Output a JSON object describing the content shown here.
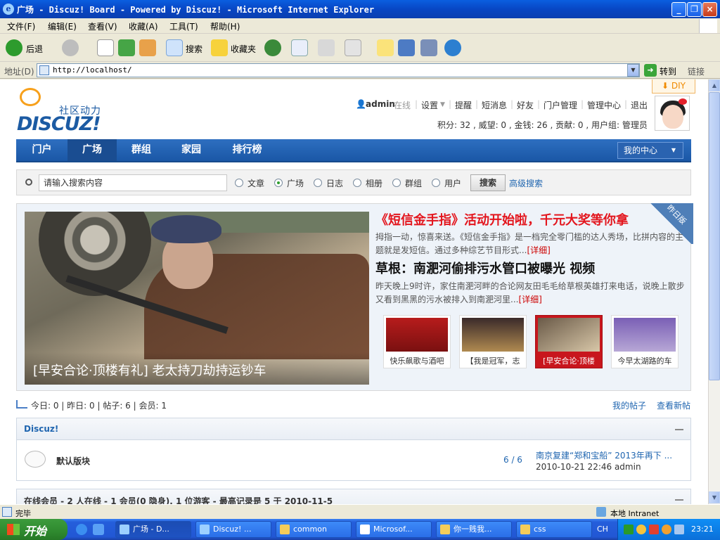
{
  "window": {
    "title": "广场 - Discuz! Board - Powered by Discuz! - Microsoft Internet Explorer"
  },
  "menu": [
    "文件(F)",
    "编辑(E)",
    "查看(V)",
    "收藏(A)",
    "工具(T)",
    "帮助(H)"
  ],
  "toolbar": {
    "back": "后退",
    "search": "搜索",
    "favorites": "收藏夹"
  },
  "address": {
    "label": "地址(D)",
    "url": "http://localhost/",
    "go": "转到",
    "links": "链接"
  },
  "header": {
    "logo_text": "DISCUZ!",
    "logo_sub": "社区动力",
    "diy": "DIY",
    "user": {
      "name": "admin",
      "status": "在线",
      "settings": "设置",
      "remind": "提醒",
      "messages": "短消息",
      "friends": "好友",
      "portal_admin": "门户管理",
      "admin_center": "管理中心",
      "logout": "退出"
    },
    "credits": "积分: 32 , 威望: 0 , 金钱: 26 , 贡献: 0 , 用户组: 管理员"
  },
  "nav": {
    "items": [
      "门户",
      "广场",
      "群组",
      "家园",
      "排行榜"
    ],
    "my_center": "我的中心"
  },
  "search": {
    "placeholder": "请输入搜索内容",
    "options": [
      "文章",
      "广场",
      "日志",
      "相册",
      "群组",
      "用户"
    ],
    "button": "搜索",
    "advanced": "高级搜索"
  },
  "feature": {
    "caption": "[早安合论·顶楼有礼] 老太持刀劫持运钞车",
    "corner": "昨日版",
    "headline1": "《短信金手指》活动开始啦，千元大奖等你拿",
    "summary1": "拇指一动，惊喜来送。《短信金手指》是一档完全零门槛的达人秀场，比拼内容的主题就是发短信。通过多种综艺节目形式...",
    "headline2": "草根：南淝河偷排污水管口被曝光 视频",
    "summary2": "昨天晚上9时许，家住南淝河畔的合论网友田毛毛给草根英雄打来电话，说晚上散步又看到黑黑的污水被排入到南淝河里...",
    "detail": "[详细]",
    "thumbs": [
      "快乐飙歌与酒吧",
      "【我是冠军，志",
      "[早安合论·顶楼",
      "今早太湖路的车"
    ]
  },
  "stats": {
    "text": "今日: 0 | 昨日: 0 | 帖子: 6 | 会员: 1",
    "my_posts": "我的帖子",
    "new_posts": "查看新帖"
  },
  "forum": {
    "category": "Discuz!",
    "name": "默认版块",
    "counts": "6 / 6",
    "last_title": "南京复建“郑和宝船” 2013年再下 ...",
    "last_info": "2010-10-21 22:46 admin"
  },
  "online": {
    "text": "在线会员 - 2 人在线 - 1 会员(0 隐身), 1 位游客 - 最高记录是 5 于 2010-11-5"
  },
  "statusbar": {
    "done": "完毕",
    "zone": "本地 Intranet"
  },
  "taskbar": {
    "start": "开始",
    "tasks": [
      "广场 - D...",
      "Discuz! ...",
      "common",
      "Microsof...",
      "你一贱我...",
      "css"
    ],
    "lang": "CH",
    "clock": "23:21"
  }
}
